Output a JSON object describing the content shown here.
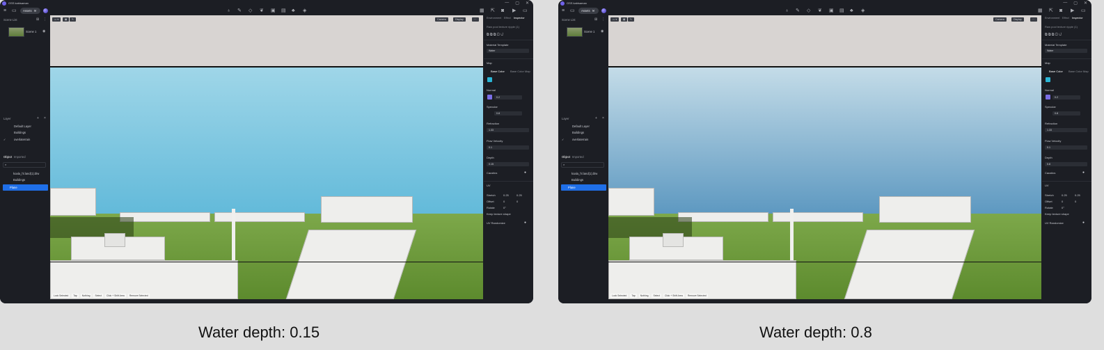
{
  "app": {
    "title": "OSS kabisaman",
    "window_buttons": [
      "—",
      "▢",
      "✕"
    ]
  },
  "toolbar": {
    "assets_label": "Assets",
    "icons": [
      "menu-icon",
      "file-icon",
      "bulb-icon",
      "pen-icon",
      "shape-icon",
      "leaf-icon",
      "box-icon",
      "panel-icon",
      "tree-icon",
      "layers-icon",
      "calendar-icon",
      "export-icon",
      "camera-icon",
      "video-icon",
      "display-icon"
    ]
  },
  "scene_list": {
    "title": "Scene List",
    "scene": "Scene 1"
  },
  "layer_panel": {
    "title": "Layer",
    "items": [
      "Default Layer",
      "Buildings",
      "overlaterrain"
    ]
  },
  "object_panel": {
    "tabs": [
      "Object",
      "Imported"
    ],
    "items": [
      "koala_hl.land(1).blw",
      "Buildings",
      "Plane"
    ]
  },
  "viewport": {
    "buttons": [
      "Camera",
      "Display"
    ],
    "status": [
      "Lock Selected",
      "Tap",
      "Nothing",
      "Select",
      "Click + Shift Area",
      "Remove Selected"
    ]
  },
  "inspector": {
    "tabs": [
      "Environment",
      "Effect",
      "Inspector"
    ],
    "subtitle": "Raw pool texture ripple (1)",
    "material_template_label": "Material Template",
    "material_value": "Water",
    "map_label": "Map",
    "base_color_tabs": [
      "Base Color",
      "Base Color Map"
    ],
    "normal_label": "Normal",
    "normal_value": "0.2",
    "specular_label": "Specular",
    "specular_value": "0.8",
    "refraction_label": "Refraction",
    "refraction_value": "1.33",
    "flow_velocity_label": "Flow Velocity",
    "flow_velocity_value": "0.1",
    "depth_label": "Depth",
    "caustics_label": "Caustics",
    "uv_label": "UV",
    "uv_rows": [
      {
        "label": "Stretch",
        "x": "0.25",
        "y": "0.25"
      },
      {
        "label": "Offset",
        "x": "0",
        "y": "0"
      },
      {
        "label": "Rotate",
        "x": "0°",
        "y": ""
      }
    ],
    "keep_texture_label": "Keep texture shape",
    "uv_randomize_label": "UV Randomize"
  },
  "panels": [
    {
      "depth_value": "0.15",
      "caption": "Water depth: 0.15",
      "water_top": "#9fd6e8",
      "water_bottom": "#5ab6d8"
    },
    {
      "depth_value": "0.8",
      "caption": "Water depth: 0.8",
      "water_top": "#c4dce8",
      "water_bottom": "#4f8fbb"
    }
  ],
  "colors": {
    "swatch_base": "#2bb6d6",
    "swatch_normal": "#7a6ee6",
    "selected_row": "#1f6fe8"
  }
}
